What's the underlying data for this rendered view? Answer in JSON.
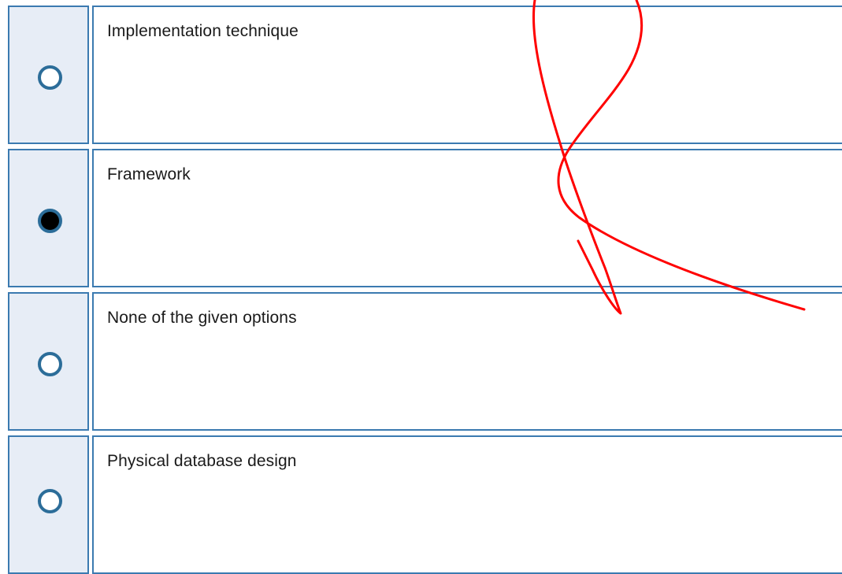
{
  "question": {
    "options": [
      {
        "label": "Implementation technique",
        "selected": false
      },
      {
        "label": "Framework",
        "selected": true
      },
      {
        "label": "None of the given options",
        "selected": false
      },
      {
        "label": "Physical database design",
        "selected": false
      }
    ]
  },
  "colors": {
    "cell_border": "#3b7ab0",
    "radio_cell_bg": "#e7edf6",
    "radio_ring": "#2c6d99",
    "radio_selected_fill": "#000000",
    "annotation_stroke": "#ff0000"
  }
}
